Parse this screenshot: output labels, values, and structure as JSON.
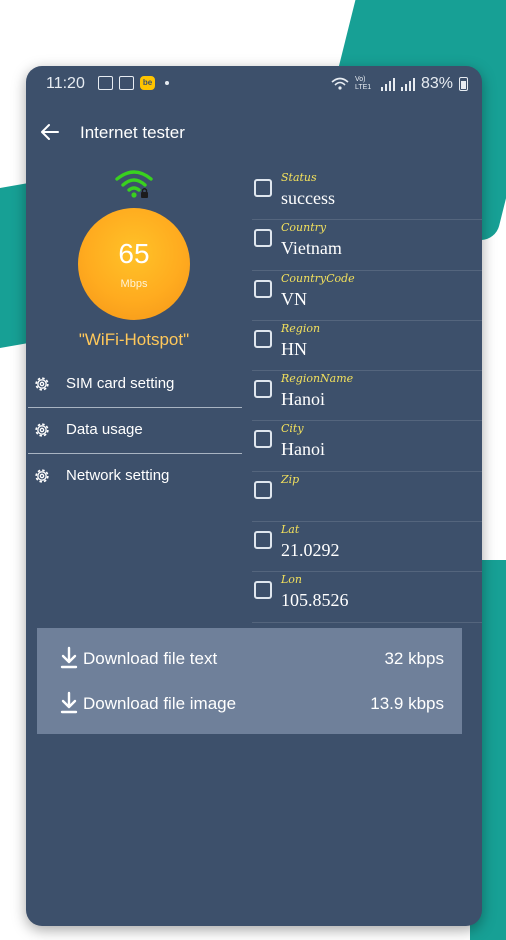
{
  "status_bar": {
    "time": "11:20",
    "battery": "83%",
    "network": "Vo) LTE1"
  },
  "app_bar": {
    "title": "Internet tester"
  },
  "connection": {
    "speed_value": "65",
    "speed_unit": "Mbps",
    "network_name": "\"WiFi-Hotspot\""
  },
  "menu": [
    {
      "label": "SIM card setting",
      "icon": "gear-icon"
    },
    {
      "label": "Data usage",
      "icon": "gear-icon"
    },
    {
      "label": "Network setting",
      "icon": "gear-icon"
    }
  ],
  "info": [
    {
      "label": "Status",
      "value": "success"
    },
    {
      "label": "Country",
      "value": "Vietnam"
    },
    {
      "label": "CountryCode",
      "value": "VN"
    },
    {
      "label": "Region",
      "value": "HN"
    },
    {
      "label": "RegionName",
      "value": "Hanoi"
    },
    {
      "label": "City",
      "value": "Hanoi"
    },
    {
      "label": "Zip",
      "value": ""
    },
    {
      "label": "Lat",
      "value": "21.0292"
    },
    {
      "label": "Lon",
      "value": "105.8526"
    }
  ],
  "downloads": [
    {
      "label": "Download file text",
      "speed": "32 kbps"
    },
    {
      "label": "Download file image",
      "speed": "13.9 kbps"
    }
  ],
  "colors": {
    "background_accent": "#17a095",
    "panel": "#3d506b",
    "gauge": "#ffab1f",
    "wifi": "#39d11f",
    "label": "#f2e05c",
    "download_panel": "#6f809a"
  }
}
